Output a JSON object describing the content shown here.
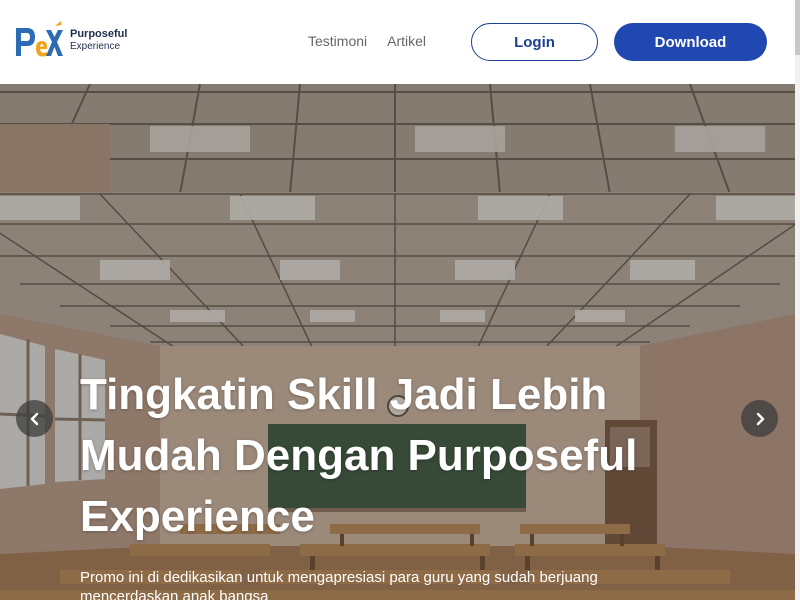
{
  "brand": {
    "logo_mark": "PeX",
    "name": "Purposeful",
    "tagline": "Experience"
  },
  "nav": {
    "items": [
      {
        "label": "Testimoni"
      },
      {
        "label": "Artikel"
      }
    ]
  },
  "header": {
    "login_label": "Login",
    "download_label": "Download"
  },
  "hero": {
    "title": "Tingkatin Skill Jadi Lebih Mudah Dengan Purposeful Experience",
    "subtitle": "Promo ini di dedikasikan untuk mengapresiasi para guru yang sudah berjuang mencerdaskan anak bangsa",
    "prev_icon": "chevron-left-icon",
    "next_icon": "chevron-right-icon"
  },
  "colors": {
    "primary": "#2148b0",
    "login_border": "#1c3f8f",
    "logo_blue": "#2d6bb5",
    "logo_orange": "#f2a31b"
  }
}
